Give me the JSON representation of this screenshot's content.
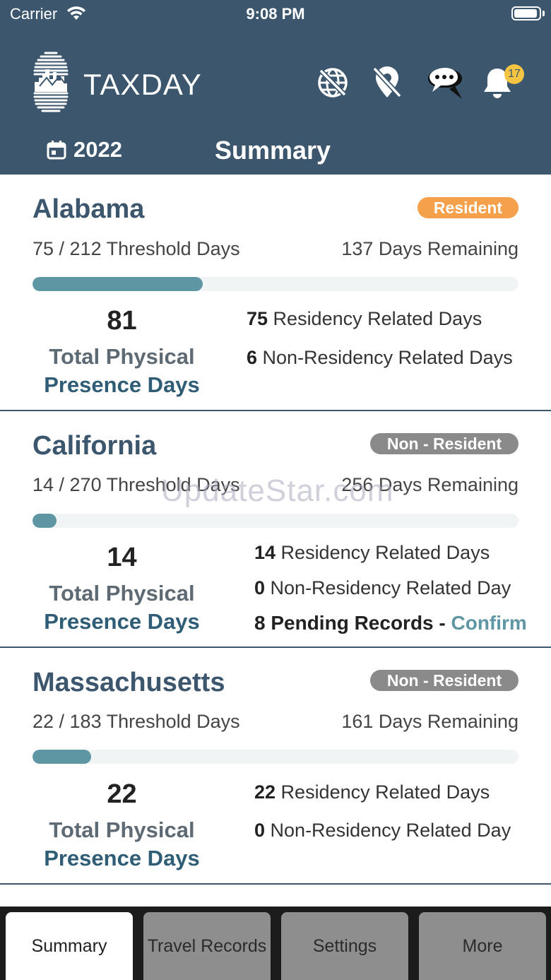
{
  "status_bar": {
    "carrier": "Carrier",
    "time": "9:08 PM"
  },
  "header": {
    "app_title": "TAXDAY",
    "notification_count": "17",
    "year": "2022",
    "page_title": "Summary",
    "icons": [
      "globe-off-icon",
      "location-off-icon",
      "chat-icon",
      "bell-icon"
    ]
  },
  "states": [
    {
      "name": "Alabama",
      "status": "Resident",
      "status_color": "#f5a04a",
      "threshold": "75 / 212 Threshold Days",
      "remaining": "137 Days Remaining",
      "progress": 0.35,
      "total_days": "81",
      "total_label_1": "Total Physical",
      "total_label_2": "Presence Days",
      "residency_num": "75",
      "residency_label": " Residency Related Days",
      "non_residency_num": "6",
      "non_residency_label": " Non-Residency Related Days"
    },
    {
      "name": "California",
      "status": "Non - Resident",
      "status_color": "#8a8a8a",
      "threshold": "14 / 270 Threshold Days",
      "remaining": "256 Days Remaining",
      "progress": 0.05,
      "total_days": "14",
      "total_label_1": "Total Physical",
      "total_label_2": "Presence Days",
      "residency_num": "14",
      "residency_label": " Residency Related Days",
      "non_residency_num": "0",
      "non_residency_label": " Non-Residency Related Day",
      "pending_text": "8 Pending Records - ",
      "confirm_label": "Confirm"
    },
    {
      "name": "Massachusetts",
      "status": "Non - Resident",
      "status_color": "#8a8a8a",
      "threshold": "22 / 183 Threshold Days",
      "remaining": "161 Days Remaining",
      "progress": 0.12,
      "total_days": "22",
      "total_label_1": "Total Physical",
      "total_label_2": "Presence Days",
      "residency_num": "22",
      "residency_label": " Residency Related Days",
      "non_residency_num": "0",
      "non_residency_label": " Non-Residency Related Day"
    }
  ],
  "watermark": "UpdateStar.com",
  "tabs": [
    "Summary",
    "Travel Records",
    "Settings",
    "More"
  ],
  "colors": {
    "header": "#3b566d",
    "accent": "#5f96a4"
  }
}
